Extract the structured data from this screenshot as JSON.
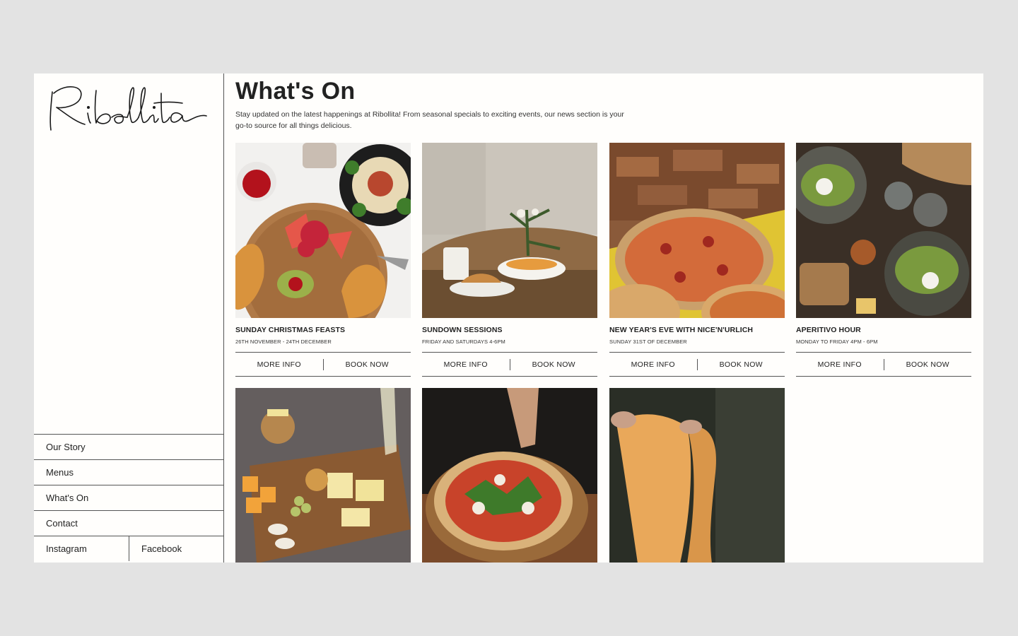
{
  "brand": {
    "logo_text": "Ribollita"
  },
  "nav": {
    "items": [
      {
        "label": "Our Story"
      },
      {
        "label": "Menus"
      },
      {
        "label": "What's On"
      },
      {
        "label": "Contact"
      }
    ],
    "social": [
      {
        "label": "Instagram"
      },
      {
        "label": "Facebook"
      }
    ]
  },
  "page": {
    "title": "What's On",
    "intro": "Stay updated on the latest happenings at Ribollita! From seasonal specials to exciting events, our news section is your go-to source for all things delicious."
  },
  "events": [
    {
      "title": "SUNDAY CHRISTMAS FEASTS",
      "date": "26TH NOVEMBER - 24TH DECEMBER",
      "more_label": "MORE INFO",
      "book_label": "BOOK NOW",
      "image": "breakfast-spread-photo"
    },
    {
      "title": "SUNDOWN SESSIONS",
      "date": "FRIDAY AND SATURDAYS 4-6PM",
      "more_label": "MORE INFO",
      "book_label": "BOOK NOW",
      "image": "table-croissant-photo"
    },
    {
      "title": "NEW YEAR'S EVE WITH NICE'N'URLICH",
      "date": "SUNDAY 31ST OF DECEMBER",
      "more_label": "MORE INFO",
      "book_label": "BOOK NOW",
      "image": "pizzas-photo"
    },
    {
      "title": "APERITIVO HOUR",
      "date": "MONDAY TO FRIDAY 4PM - 6PM",
      "more_label": "MORE INFO",
      "book_label": "BOOK NOW",
      "image": "avocado-toast-photo"
    }
  ],
  "gallery": [
    {
      "image": "cheese-board-photo"
    },
    {
      "image": "pizza-arugula-photo"
    },
    {
      "image": "fresh-pasta-photo"
    }
  ],
  "colors": {
    "background": "#e3e3e3",
    "panel": "#fffefc",
    "text": "#222222",
    "rule": "#555555"
  }
}
